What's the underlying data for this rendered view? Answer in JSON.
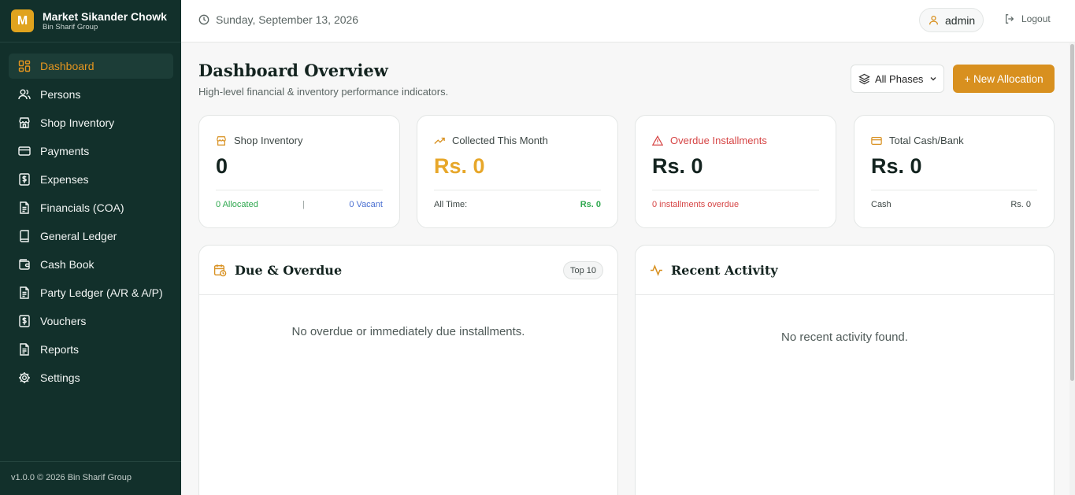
{
  "brand": {
    "logo_letter": "M",
    "name": "Market Sikander Chowk",
    "subtitle": "Bin Sharif Group"
  },
  "sidebar": {
    "items": [
      {
        "label": "Dashboard",
        "icon": "dashboard-icon",
        "active": true
      },
      {
        "label": "Persons",
        "icon": "users-icon"
      },
      {
        "label": "Shop Inventory",
        "icon": "store-icon"
      },
      {
        "label": "Payments",
        "icon": "credit-card-icon"
      },
      {
        "label": "Expenses",
        "icon": "dollar-file-icon"
      },
      {
        "label": "Financials (COA)",
        "icon": "document-icon"
      },
      {
        "label": "General Ledger",
        "icon": "book-icon"
      },
      {
        "label": "Cash Book",
        "icon": "wallet-icon"
      },
      {
        "label": "Party Ledger (A/R & A/P)",
        "icon": "document-icon"
      },
      {
        "label": "Vouchers",
        "icon": "dollar-file-icon"
      },
      {
        "label": "Reports",
        "icon": "document-icon"
      },
      {
        "label": "Settings",
        "icon": "gear-icon"
      }
    ],
    "footer": "v1.0.0 © 2026 Bin Sharif Group"
  },
  "topbar": {
    "date": "Sunday, September 13, 2026",
    "user": "admin",
    "logout": "Logout"
  },
  "main": {
    "title": "Dashboard Overview",
    "subtitle": "High-level financial & inventory performance indicators.",
    "phase_select": "All Phases",
    "new_button": "+ New Allocation"
  },
  "stats": [
    {
      "title": "Shop Inventory",
      "value": "0",
      "foot_left": "0 Allocated",
      "foot_sep": "|",
      "foot_right": "0 Vacant"
    },
    {
      "title": "Collected This Month",
      "value": "Rs. 0",
      "foot_left": "All Time:",
      "foot_right": "Rs. 0"
    },
    {
      "title": "Overdue Installments",
      "value": "Rs. 0",
      "foot_left": "0 installments overdue"
    },
    {
      "title": "Total Cash/Bank",
      "value": "Rs. 0",
      "foot_left": "Cash",
      "foot_right": "Rs. 0"
    }
  ],
  "panels": {
    "due": {
      "title": "Due & Overdue",
      "badge": "Top 10",
      "empty": "No overdue or immediately due installments."
    },
    "activity": {
      "title": "Recent Activity",
      "empty": "No recent activity found."
    }
  },
  "colors": {
    "sidebar": "#12302b",
    "accent": "#d8901f",
    "danger": "#d64545",
    "success": "#2fa84f",
    "info": "#4a6fd1"
  }
}
